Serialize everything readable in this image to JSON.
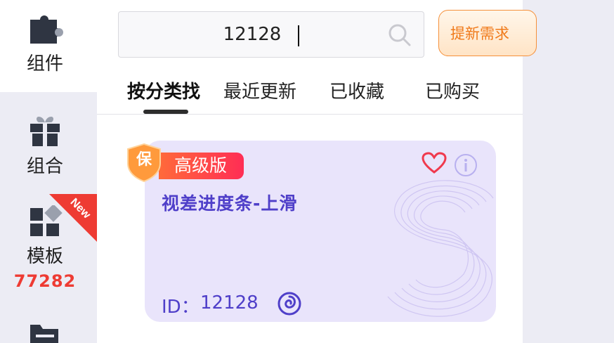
{
  "sidebar": {
    "items": [
      {
        "label": "组件",
        "icon": "puzzle-icon",
        "active": true
      },
      {
        "label": "组合",
        "icon": "gift-icon",
        "active": false
      },
      {
        "label": "模板",
        "icon": "template-grid-icon",
        "count": "77282",
        "active": false
      },
      {
        "label": "",
        "icon": "folder-doc-icon",
        "active": false
      }
    ],
    "ribbon_text": "New"
  },
  "search": {
    "value": "12128"
  },
  "request_button": {
    "label": "提新需求"
  },
  "tabs": [
    {
      "label": "按分类找",
      "active": true
    },
    {
      "label": "最近更新",
      "active": false
    },
    {
      "label": "已收藏",
      "active": false
    },
    {
      "label": "已购买",
      "active": false
    }
  ],
  "card": {
    "badge": "高级版",
    "badge_shield_char": "保",
    "title": "视差进度条-上滑",
    "id_label": "ID：",
    "id_value": "12128"
  },
  "colors": {
    "accent_purple": "#4f3fc9",
    "card_bg": "#e9e4fb",
    "badge_red": "#ff2d55",
    "orange": "#f07a1a",
    "count_red": "#ee3b33"
  }
}
